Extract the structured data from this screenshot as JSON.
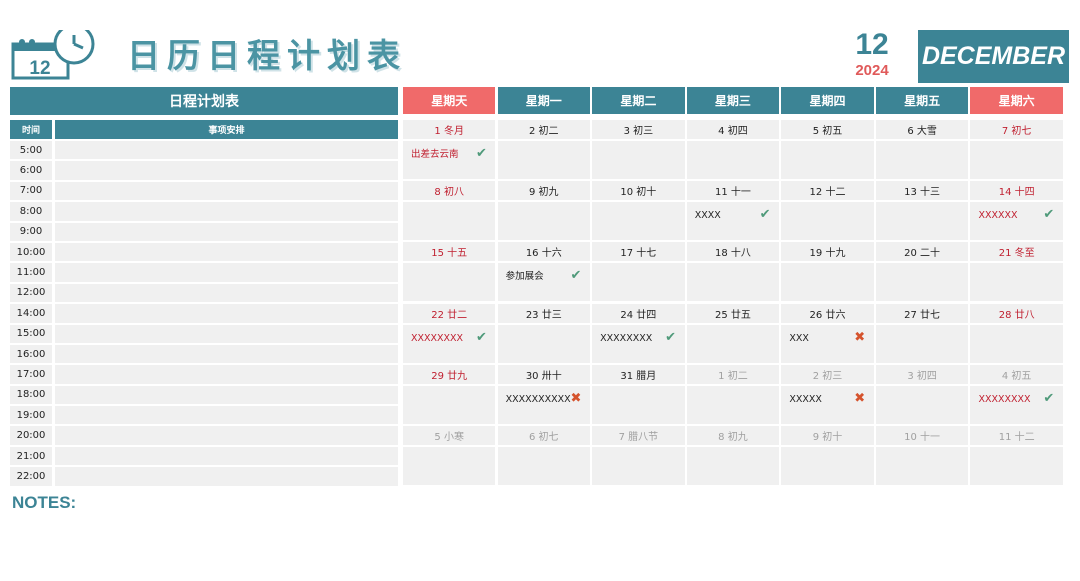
{
  "header": {
    "logo_number": "12",
    "title": "日历日程计划表",
    "month_number": "12",
    "year": "2024",
    "month_name": "DECEMBER"
  },
  "schedule": {
    "title": "日程计划表",
    "time_header": "时间",
    "items_header": "事项安排",
    "times": [
      "5:00",
      "6:00",
      "7:00",
      "8:00",
      "9:00",
      "10:00",
      "11:00",
      "12:00",
      "14:00",
      "15:00",
      "16:00",
      "17:00",
      "18:00",
      "19:00",
      "20:00",
      "21:00",
      "22:00"
    ]
  },
  "calendar": {
    "weekdays": [
      "星期天",
      "星期一",
      "星期二",
      "星期三",
      "星期四",
      "星期五",
      "星期六"
    ],
    "weeks": [
      [
        {
          "date": "1 冬月",
          "kind": "weekend",
          "note": "出差去云南",
          "note_color": "red",
          "mark": "check"
        },
        {
          "date": "2 初二",
          "kind": "normal"
        },
        {
          "date": "3 初三",
          "kind": "normal"
        },
        {
          "date": "4 初四",
          "kind": "normal"
        },
        {
          "date": "5 初五",
          "kind": "normal"
        },
        {
          "date": "6 大雪",
          "kind": "normal"
        },
        {
          "date": "7 初七",
          "kind": "weekend"
        }
      ],
      [
        {
          "date": "8 初八",
          "kind": "weekend"
        },
        {
          "date": "9 初九",
          "kind": "normal"
        },
        {
          "date": "10 初十",
          "kind": "normal"
        },
        {
          "date": "11 十一",
          "kind": "normal",
          "note": "XXXX",
          "note_color": "dark",
          "mark": "check"
        },
        {
          "date": "12 十二",
          "kind": "normal"
        },
        {
          "date": "13 十三",
          "kind": "normal"
        },
        {
          "date": "14 十四",
          "kind": "weekend",
          "note": "XXXXXX",
          "note_color": "red",
          "mark": "check"
        }
      ],
      [
        {
          "date": "15 十五",
          "kind": "weekend"
        },
        {
          "date": "16 十六",
          "kind": "normal",
          "note": "参加展会",
          "note_color": "dark",
          "mark": "check"
        },
        {
          "date": "17 十七",
          "kind": "normal"
        },
        {
          "date": "18 十八",
          "kind": "normal"
        },
        {
          "date": "19 十九",
          "kind": "normal"
        },
        {
          "date": "20 二十",
          "kind": "normal"
        },
        {
          "date": "21 冬至",
          "kind": "weekend"
        }
      ],
      [
        {
          "date": "22 廿二",
          "kind": "weekend",
          "note": "XXXXXXXX",
          "note_color": "red",
          "mark": "check"
        },
        {
          "date": "23 廿三",
          "kind": "normal"
        },
        {
          "date": "24 廿四",
          "kind": "normal",
          "note": "XXXXXXXX",
          "note_color": "dark",
          "mark": "check"
        },
        {
          "date": "25 廿五",
          "kind": "normal"
        },
        {
          "date": "26 廿六",
          "kind": "normal",
          "note": "XXX",
          "note_color": "dark",
          "mark": "cross"
        },
        {
          "date": "27 廿七",
          "kind": "normal"
        },
        {
          "date": "28 廿八",
          "kind": "weekend"
        }
      ],
      [
        {
          "date": "29 廿九",
          "kind": "weekend"
        },
        {
          "date": "30 卅十",
          "kind": "normal",
          "note": "XXXXXXXXXX",
          "note_color": "dark",
          "mark": "cross"
        },
        {
          "date": "31 腊月",
          "kind": "normal"
        },
        {
          "date": "1 初二",
          "kind": "other"
        },
        {
          "date": "2 初三",
          "kind": "other",
          "note": "XXXXX",
          "note_color": "dark",
          "mark": "cross"
        },
        {
          "date": "3 初四",
          "kind": "other"
        },
        {
          "date": "4 初五",
          "kind": "other",
          "note": "XXXXXXXX",
          "note_color": "red",
          "mark": "check"
        }
      ],
      [
        {
          "date": "5 小寒",
          "kind": "other"
        },
        {
          "date": "6 初七",
          "kind": "other"
        },
        {
          "date": "7 腊八节",
          "kind": "other"
        },
        {
          "date": "8 初九",
          "kind": "other"
        },
        {
          "date": "9 初十",
          "kind": "other"
        },
        {
          "date": "10 十一",
          "kind": "other"
        },
        {
          "date": "11 十二",
          "kind": "other"
        }
      ]
    ]
  },
  "notes": {
    "label": "NOTES:"
  },
  "marks": {
    "check": "✔",
    "cross": "✖"
  }
}
